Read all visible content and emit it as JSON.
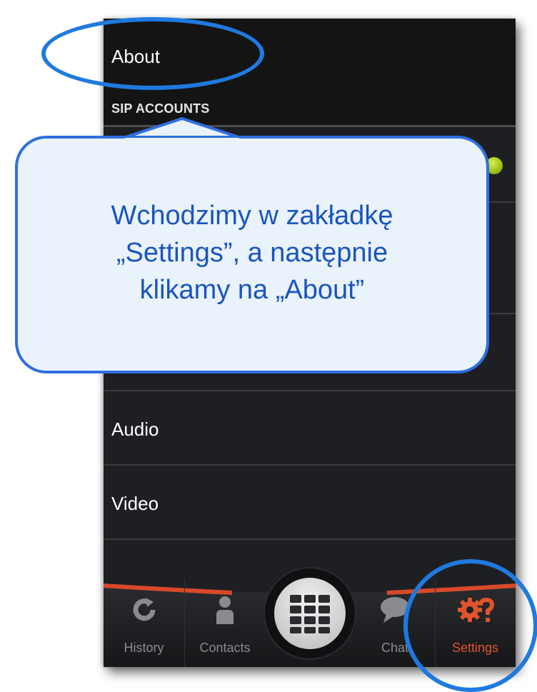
{
  "settings_list": {
    "about_label": "About",
    "sip_accounts_header": "SIP ACCOUNTS",
    "audio_label": "Audio",
    "video_label": "Video"
  },
  "tabbar": {
    "history_label": "History",
    "contacts_label": "Contacts",
    "chat_label": "Chat",
    "settings_label": "Settings",
    "dialpad_icon": "dialpad-icon"
  },
  "callout": {
    "line1": "Wchodzimy w zakładkę",
    "line2": "„Settings”,  a następnie",
    "line3": "klikamy na „About”"
  },
  "colors": {
    "accent_settings": "#e0532d",
    "annotation_blue": "#1f7ae0",
    "callout_text": "#1a55c0",
    "status_dot": "#a5c81e"
  }
}
